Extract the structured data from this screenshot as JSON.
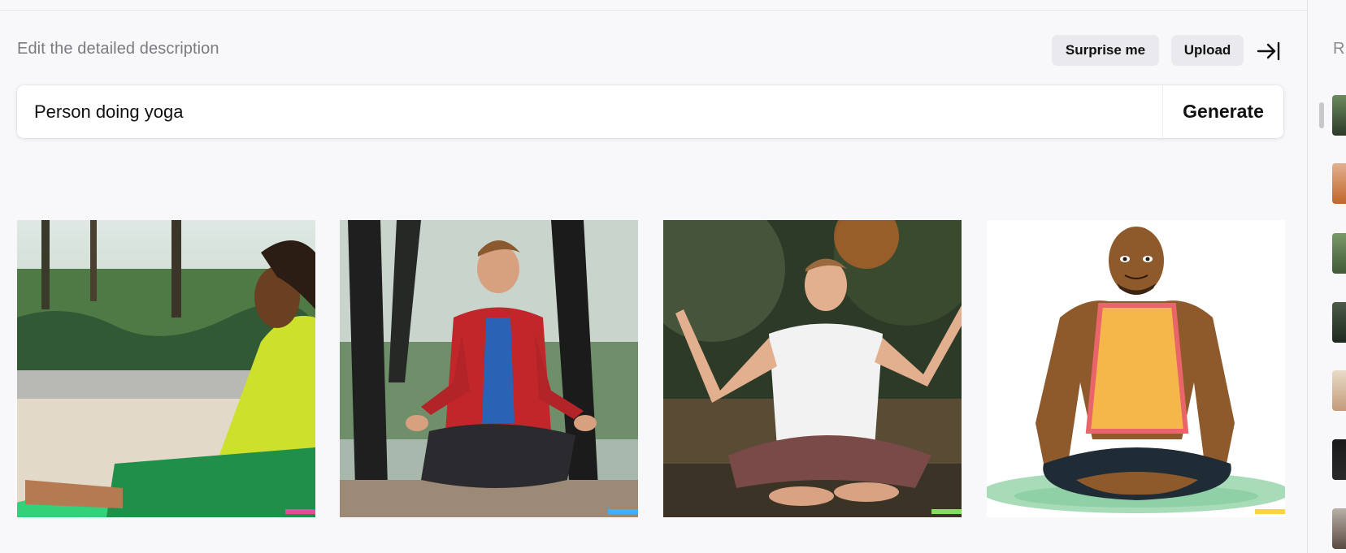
{
  "header": {
    "description_label": "Edit the detailed description",
    "surprise_label": "Surprise me",
    "upload_label": "Upload"
  },
  "prompt": {
    "value": "Person doing yoga",
    "generate_label": "Generate"
  },
  "results": [
    {
      "name": "yoga-image-1",
      "subject": "man with dreadlocks stretching on green mat in park"
    },
    {
      "name": "yoga-image-2",
      "subject": "man in red plaid shirt meditating among trees"
    },
    {
      "name": "yoga-image-3",
      "subject": "man in white t-shirt floating cross-legged"
    },
    {
      "name": "yoga-image-4",
      "subject": "cartoon bald man meditating"
    }
  ],
  "sidebar": {
    "label": "R"
  },
  "colors": {
    "background": "#f8f8fa",
    "pill": "#e9e9ee",
    "text": "#111111",
    "muted": "#7a7a80"
  }
}
